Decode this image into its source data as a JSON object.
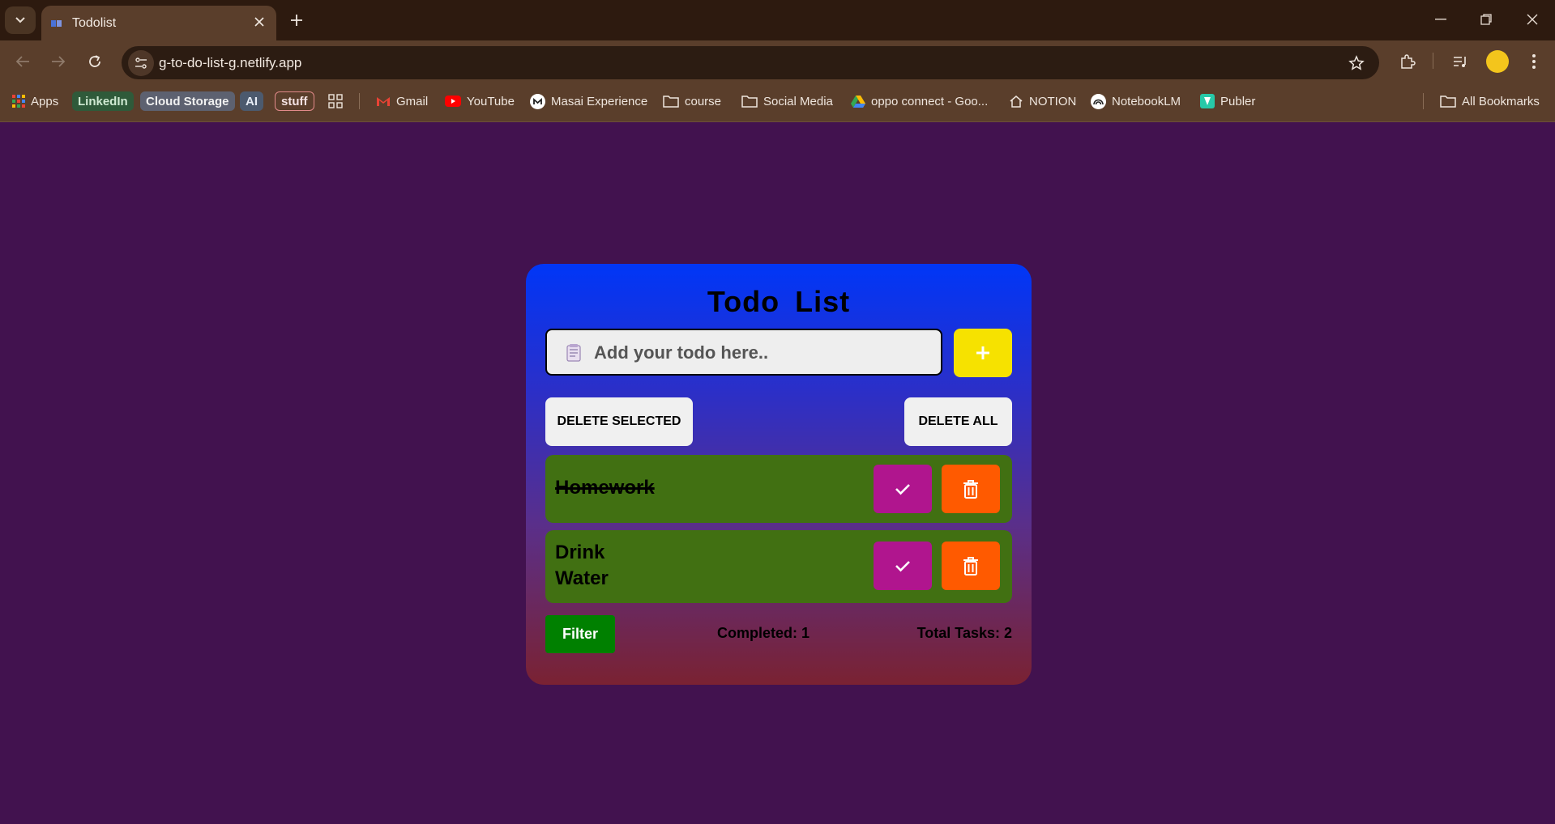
{
  "browser": {
    "tab_title": "Todolist",
    "url": "g-to-do-list-g.netlify.app",
    "bookmarks": {
      "apps": "Apps",
      "linkedin": "LinkedIn",
      "cloud_storage": "Cloud Storage",
      "ai": "AI",
      "stuff": "stuff",
      "gmail": "Gmail",
      "youtube": "YouTube",
      "masai": "Masai Experience",
      "course": "course",
      "social_media": "Social Media",
      "oppo": "oppo connect - Goo...",
      "notion": "NOTION",
      "notebooklm": "NotebookLM",
      "publer": "Publer",
      "all_bookmarks": "All Bookmarks"
    }
  },
  "app": {
    "title": "Todo List",
    "input_placeholder": "Add your todo here..",
    "add_label": "+",
    "delete_selected_label": "DELETE SELECTED",
    "delete_all_label": "DELETE ALL",
    "todos": [
      {
        "text": "Homework",
        "completed": true
      },
      {
        "text_line1": "Drink",
        "text_line2": "Water",
        "completed": false
      }
    ],
    "filter_label": "Filter",
    "completed_text": "Completed: 1",
    "total_text": "Total Tasks: 2"
  },
  "colors": {
    "page_bg": "#42124f",
    "card_top": "#0036f7",
    "card_bottom": "#7a2232",
    "add_button": "#f6e200",
    "todo_bg": "#417012",
    "check_button": "#b0158e",
    "trash_button": "#ff5a00",
    "filter_button": "#008000"
  }
}
